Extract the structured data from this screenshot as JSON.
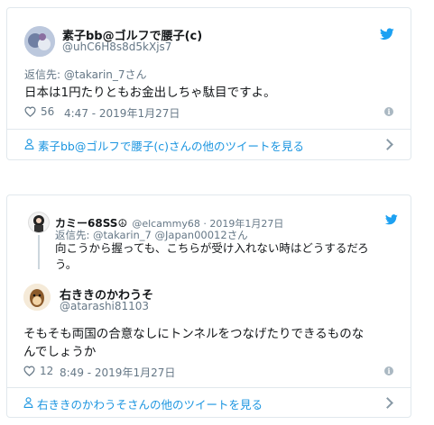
{
  "tweet1": {
    "display_name": "素子bb@ゴルフで腰子(c)",
    "handle": "@uhC6H8s8d5kXjs7",
    "reply_prefix": "返信先: ",
    "reply_to": "@takarin_7",
    "reply_suffix": "さん",
    "text": "日本は1円たりともお金出しちゃ駄目ですよ。",
    "likes": "56",
    "timestamp": "4:47 - 2019年1月27日",
    "footer_link": "素子bb@ゴルフで腰子(c)さんの他のツイートを見る",
    "colors": {
      "twitter_blue": "#1da1f2"
    }
  },
  "tweet2": {
    "parent": {
      "display_name": "カミー68SS☮",
      "handle": "@elcammy68",
      "date": " · 2019年1月27日",
      "reply_prefix": "返信先: ",
      "reply_to": "@takarin_7 @Japan00012",
      "reply_suffix": "さん",
      "text_line1": "向こうから握っても、こちらが受け入れない時はどうするだろ",
      "text_line2": "う。"
    },
    "display_name": "右ききのかわうそ",
    "handle": "@atarashi81103",
    "text_line1": "そもそも両国の合意なしにトンネルをつなげたりできるものな",
    "text_line2": "んでしょうか",
    "likes": "12",
    "timestamp": "8:49 - 2019年1月27日",
    "footer_link": "右ききのかわうそさんの他のツイートを見る"
  }
}
